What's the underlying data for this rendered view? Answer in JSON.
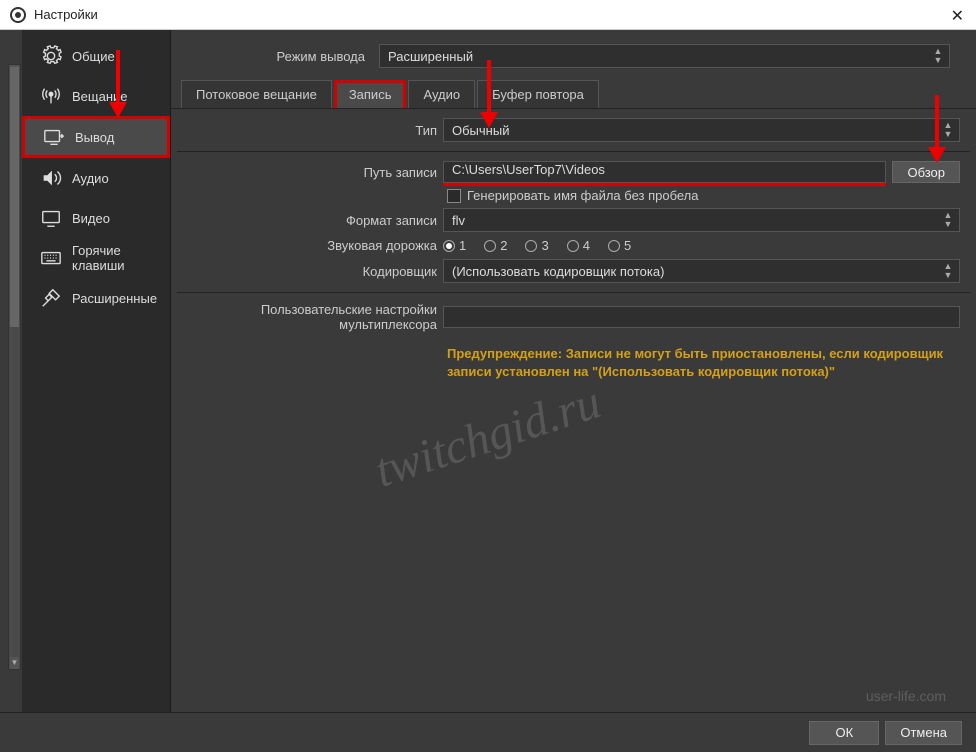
{
  "window": {
    "title": "Настройки"
  },
  "sidebar": {
    "items": [
      {
        "label": "Общие",
        "icon": "gear-icon"
      },
      {
        "label": "Вещание",
        "icon": "broadcast-icon"
      },
      {
        "label": "Вывод",
        "icon": "output-icon",
        "selected": true
      },
      {
        "label": "Аудио",
        "icon": "audio-icon"
      },
      {
        "label": "Видео",
        "icon": "video-icon"
      },
      {
        "label": "Горячие клавиши",
        "icon": "keyboard-icon"
      },
      {
        "label": "Расширенные",
        "icon": "tools-icon"
      }
    ]
  },
  "topRow": {
    "label": "Режим вывода",
    "value": "Расширенный"
  },
  "tabs": [
    {
      "label": "Потоковое вещание"
    },
    {
      "label": "Запись",
      "active": true
    },
    {
      "label": "Аудио"
    },
    {
      "label": "Буфер повтора"
    }
  ],
  "recording": {
    "typeLabel": "Тип",
    "typeValue": "Обычный",
    "pathLabel": "Путь записи",
    "pathValue": "C:\\Users\\UserTop7\\Videos",
    "browseBtn": "Обзор",
    "noSpaceLabel": "Генерировать имя файла без пробела",
    "formatLabel": "Формат записи",
    "formatValue": "flv",
    "trackLabel": "Звуковая дорожка",
    "tracks": [
      "1",
      "2",
      "3",
      "4",
      "5"
    ],
    "trackSelected": "1",
    "encoderLabel": "Кодировщик",
    "encoderValue": "(Использовать кодировщик потока)",
    "muxLabel": "Пользовательские настройки мультиплексора",
    "muxValue": "",
    "warning": "Предупреждение: Записи не могут быть приостановлены, если кодировщик записи установлен на \"(Использовать кодировщик потока)\""
  },
  "footer": {
    "ok": "ОК",
    "cancel": "Отмена"
  },
  "watermark": "twitchgid.ru",
  "bottomWatermark": "user-life.com"
}
